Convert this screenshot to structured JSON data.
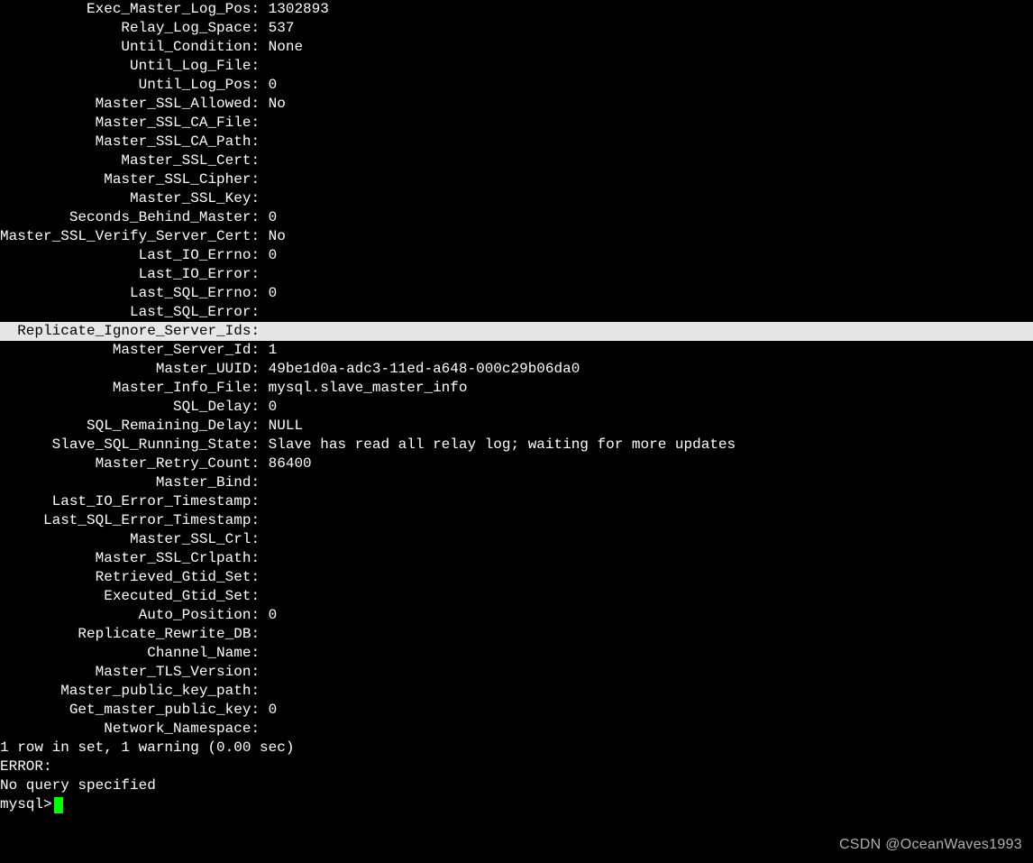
{
  "rows": [
    {
      "key": "Exec_Master_Log_Pos:",
      "val": " 1302893",
      "hl": false
    },
    {
      "key": "Relay_Log_Space:",
      "val": " 537",
      "hl": false
    },
    {
      "key": "Until_Condition:",
      "val": " None",
      "hl": false
    },
    {
      "key": "Until_Log_File:",
      "val": "",
      "hl": false
    },
    {
      "key": "Until_Log_Pos:",
      "val": " 0",
      "hl": false
    },
    {
      "key": "Master_SSL_Allowed:",
      "val": " No",
      "hl": false
    },
    {
      "key": "Master_SSL_CA_File:",
      "val": "",
      "hl": false
    },
    {
      "key": "Master_SSL_CA_Path:",
      "val": "",
      "hl": false
    },
    {
      "key": "Master_SSL_Cert:",
      "val": "",
      "hl": false
    },
    {
      "key": "Master_SSL_Cipher:",
      "val": "",
      "hl": false
    },
    {
      "key": "Master_SSL_Key:",
      "val": "",
      "hl": false
    },
    {
      "key": "Seconds_Behind_Master:",
      "val": " 0",
      "hl": false
    },
    {
      "key": "Master_SSL_Verify_Server_Cert:",
      "val": " No",
      "hl": false
    },
    {
      "key": "Last_IO_Errno:",
      "val": " 0",
      "hl": false
    },
    {
      "key": "Last_IO_Error:",
      "val": "",
      "hl": false
    },
    {
      "key": "Last_SQL_Errno:",
      "val": " 0",
      "hl": false
    },
    {
      "key": "Last_SQL_Error:",
      "val": "",
      "hl": false
    },
    {
      "key": "Replicate_Ignore_Server_Ids:",
      "val": "",
      "hl": true
    },
    {
      "key": "Master_Server_Id:",
      "val": " 1",
      "hl": false
    },
    {
      "key": "Master_UUID:",
      "val": " 49be1d0a-adc3-11ed-a648-000c29b06da0",
      "hl": false
    },
    {
      "key": "Master_Info_File:",
      "val": " mysql.slave_master_info",
      "hl": false
    },
    {
      "key": "SQL_Delay:",
      "val": " 0",
      "hl": false
    },
    {
      "key": "SQL_Remaining_Delay:",
      "val": " NULL",
      "hl": false
    },
    {
      "key": "Slave_SQL_Running_State:",
      "val": " Slave has read all relay log; waiting for more updates",
      "hl": false
    },
    {
      "key": "Master_Retry_Count:",
      "val": " 86400",
      "hl": false
    },
    {
      "key": "Master_Bind:",
      "val": "",
      "hl": false
    },
    {
      "key": "Last_IO_Error_Timestamp:",
      "val": "",
      "hl": false
    },
    {
      "key": "Last_SQL_Error_Timestamp:",
      "val": "",
      "hl": false
    },
    {
      "key": "Master_SSL_Crl:",
      "val": "",
      "hl": false
    },
    {
      "key": "Master_SSL_Crlpath:",
      "val": "",
      "hl": false
    },
    {
      "key": "Retrieved_Gtid_Set:",
      "val": "",
      "hl": false
    },
    {
      "key": "Executed_Gtid_Set:",
      "val": "",
      "hl": false
    },
    {
      "key": "Auto_Position:",
      "val": " 0",
      "hl": false
    },
    {
      "key": "Replicate_Rewrite_DB:",
      "val": "",
      "hl": false
    },
    {
      "key": "Channel_Name:",
      "val": "",
      "hl": false
    },
    {
      "key": "Master_TLS_Version:",
      "val": "",
      "hl": false
    },
    {
      "key": "Master_public_key_path:",
      "val": "",
      "hl": false
    },
    {
      "key": "Get_master_public_key:",
      "val": " 0",
      "hl": false
    },
    {
      "key": "Network_Namespace:",
      "val": "",
      "hl": false
    }
  ],
  "footer": {
    "result": "1 row in set, 1 warning (0.00 sec)",
    "blank1": "",
    "error": "ERROR:",
    "noquery": "No query specified",
    "blank2": "",
    "prompt": "mysql> "
  },
  "watermark": "CSDN @OceanWaves1993"
}
